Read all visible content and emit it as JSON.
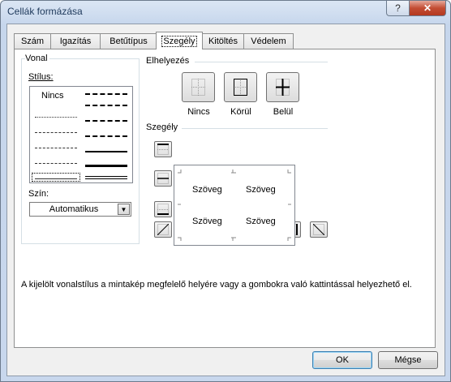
{
  "window": {
    "title": "Cellák formázása",
    "help_label": "?",
    "close_label": "✕"
  },
  "tabs": [
    {
      "label": "Szám"
    },
    {
      "label": "Igazítás"
    },
    {
      "label": "Betűtípus"
    },
    {
      "label": "Szegély",
      "active": true
    },
    {
      "label": "Kitöltés"
    },
    {
      "label": "Védelem"
    }
  ],
  "line_group": {
    "title": "Vonal",
    "style_label": "Stílus:",
    "none_label": "Nincs",
    "color_label": "Szín:",
    "color_value": "Automatikus"
  },
  "presets": {
    "title": "Elhelyezés",
    "items": [
      {
        "label": "Nincs",
        "icon": "border-none-icon"
      },
      {
        "label": "Körül",
        "icon": "border-outline-icon"
      },
      {
        "label": "Belül",
        "icon": "border-inside-icon"
      }
    ]
  },
  "border": {
    "title": "Szegély",
    "preview_texts": [
      "Szöveg",
      "Szöveg",
      "Szöveg",
      "Szöveg"
    ]
  },
  "info_text": "A kijelölt vonalstílus a mintakép megfelelő helyére vagy a gombokra való kattintással helyezhető el.",
  "buttons": {
    "ok": "OK",
    "cancel": "Mégse"
  },
  "colors": {
    "accent": "#3c7fb1",
    "close": "#c34d33",
    "title_text": "#1e395b"
  }
}
